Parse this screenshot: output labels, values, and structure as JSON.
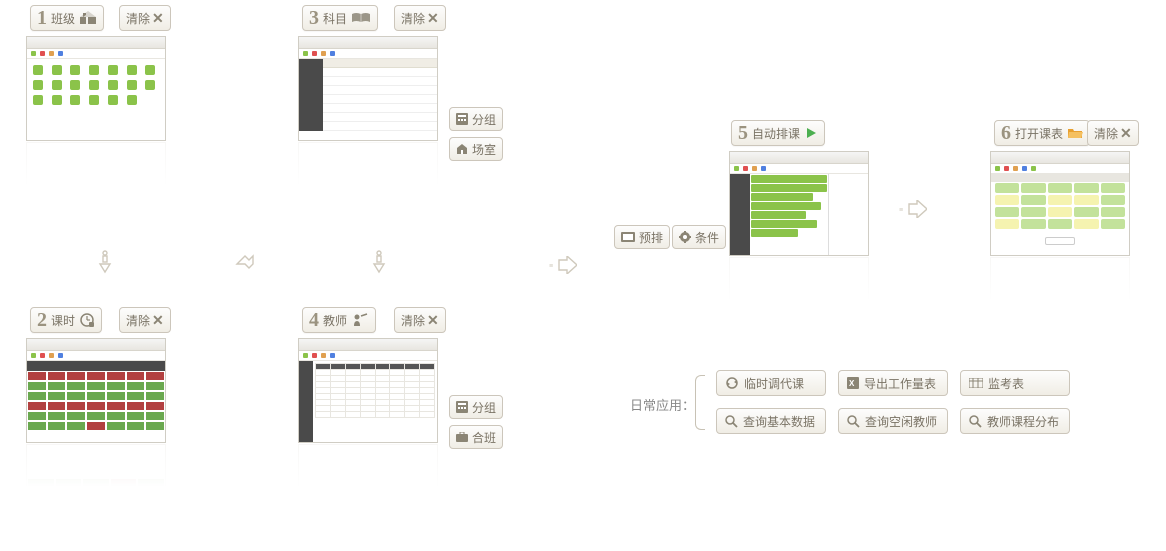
{
  "steps": {
    "s1": {
      "num": "1",
      "label": "班级",
      "clear": "清除"
    },
    "s2": {
      "num": "2",
      "label": "课时",
      "clear": "清除"
    },
    "s3": {
      "num": "3",
      "label": "科目",
      "clear": "清除",
      "group": "分组",
      "room": "场室"
    },
    "s4": {
      "num": "4",
      "label": "教师",
      "clear": "清除",
      "group": "分组",
      "merge": "合班"
    },
    "s5": {
      "num": "5",
      "label": "自动排课",
      "pre": "预排",
      "cond": "条件"
    },
    "s6": {
      "num": "6",
      "label": "打开课表",
      "clear": "清除"
    }
  },
  "daily_label": "日常应用：",
  "actions": {
    "a1": "临时调代课",
    "a2": "导出工作量表",
    "a3": "监考表",
    "a4": "查询基本数据",
    "a5": "查询空闲教师",
    "a6": "教师课程分布"
  }
}
